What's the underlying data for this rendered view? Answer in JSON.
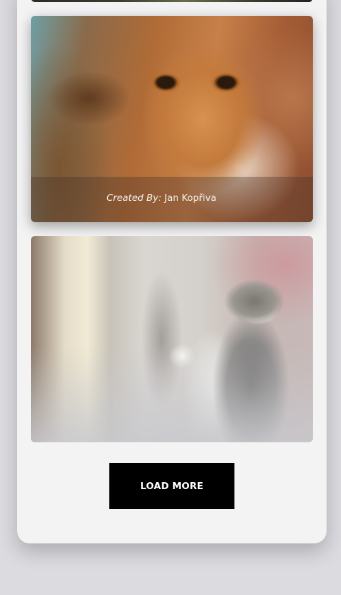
{
  "gallery": {
    "items": [
      {
        "image": "tabby-cat-top-photo"
      },
      {
        "image": "orange-tabby-cat-photo",
        "caption_prefix": "Created By:",
        "caption_author": "Jan Kopřiva"
      },
      {
        "image": "grey-white-cat-begging-photo"
      }
    ]
  },
  "actions": {
    "load_more_label": "LOAD MORE"
  },
  "colors": {
    "page_background": "#dcdbe0",
    "card_background": "#f3f3f4",
    "button_background": "#000000",
    "button_text": "#ffffff"
  }
}
